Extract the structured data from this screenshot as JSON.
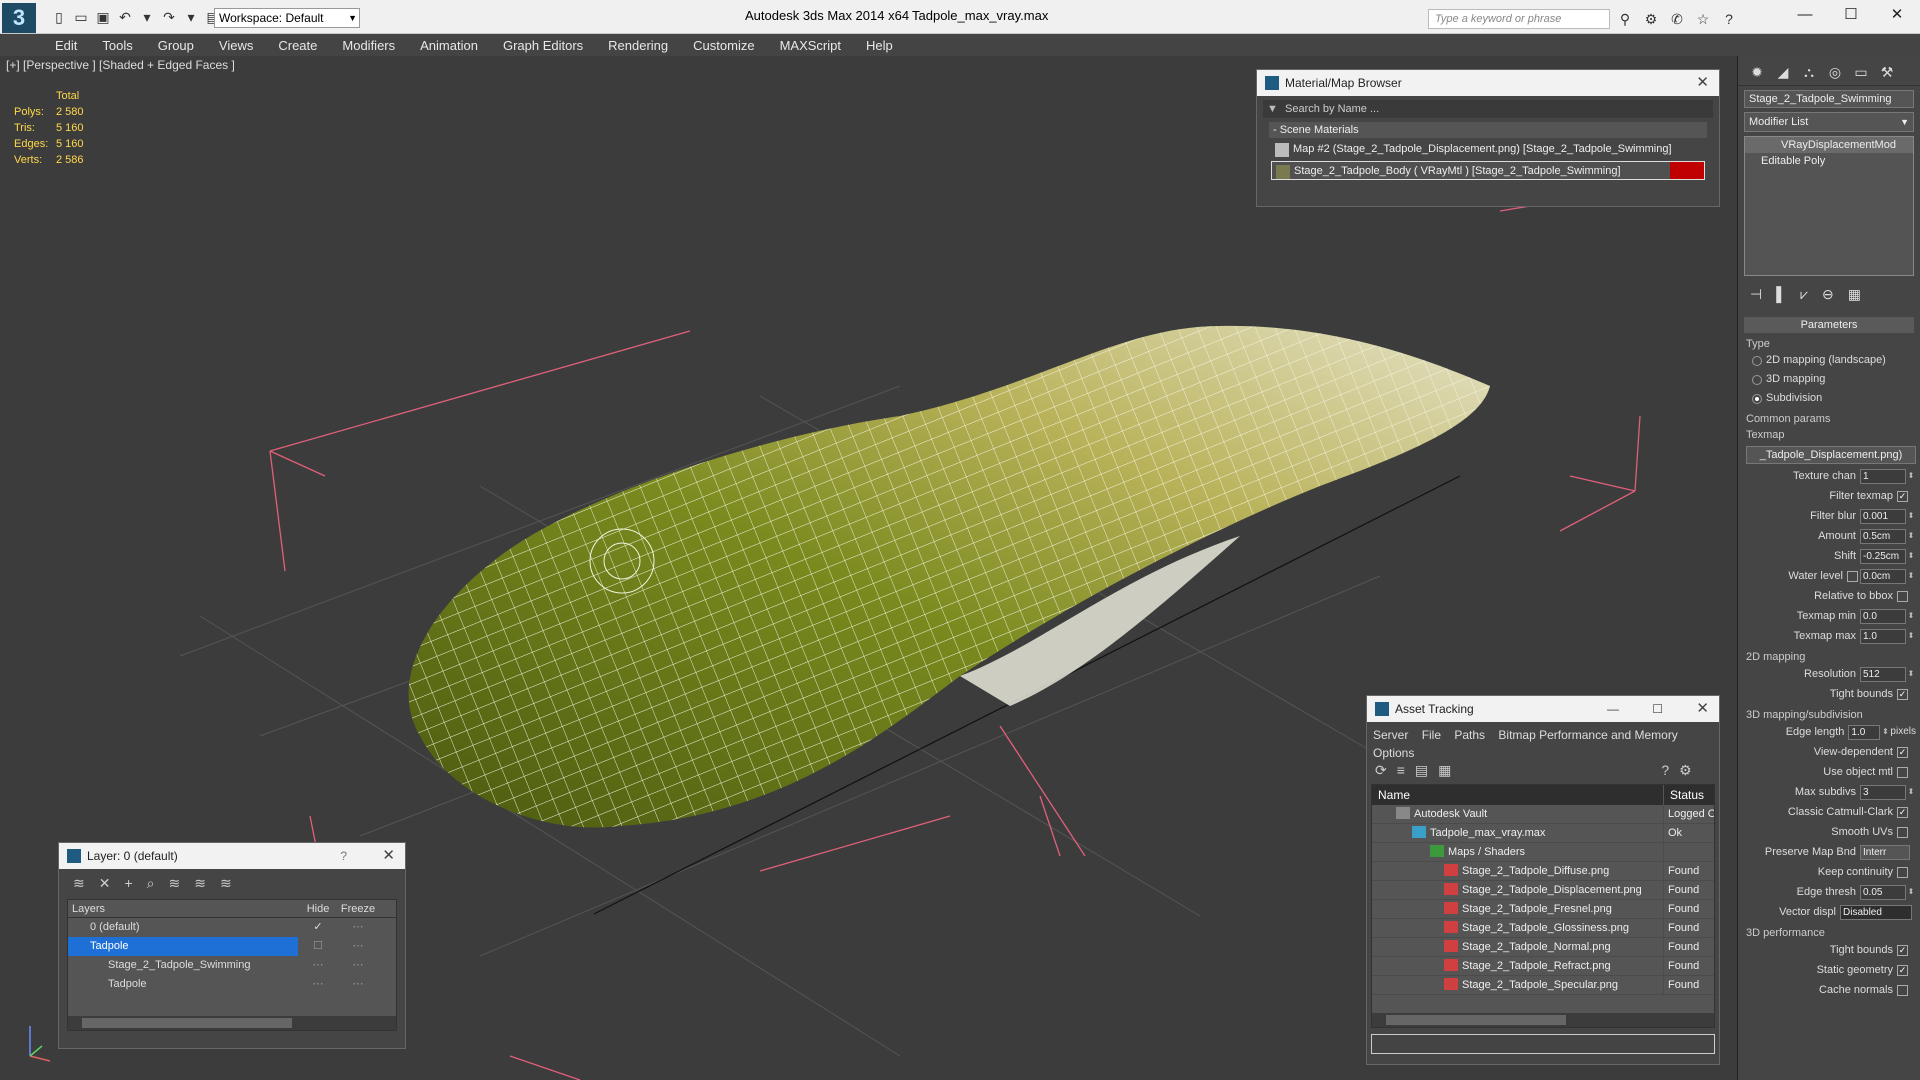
{
  "titlebar": {
    "workspace": "Workspace: Default",
    "app_title": "Autodesk 3ds Max  2014 x64",
    "file_title": "Tadpole_max_vray.max",
    "search_placeholder": "Type a keyword or phrase"
  },
  "menu": [
    "Edit",
    "Tools",
    "Group",
    "Views",
    "Create",
    "Modifiers",
    "Animation",
    "Graph Editors",
    "Rendering",
    "Customize",
    "MAXScript",
    "Help"
  ],
  "viewport": {
    "label": "[+] [Perspective ] [Shaded + Edged Faces ]",
    "stats": {
      "total_label": "Total",
      "polys_label": "Polys:",
      "polys": "2 580",
      "tris_label": "Tris:",
      "tris": "5 160",
      "edges_label": "Edges:",
      "edges": "5 160",
      "verts_label": "Verts:",
      "verts": "2 586"
    }
  },
  "material_browser": {
    "title": "Material/Map Browser",
    "search_placeholder": "Search by Name ...",
    "section": "- Scene Materials",
    "items": [
      "Map #2 (Stage_2_Tadpole_Displacement.png)  [Stage_2_Tadpole_Swimming]",
      "Stage_2_Tadpole_Body  ( VRayMtl )  [Stage_2_Tadpole_Swimming]"
    ]
  },
  "command_panel": {
    "object_name": "Stage_2_Tadpole_Swimming",
    "modifier_list": "Modifier List",
    "stack": [
      "VRayDisplacementMod",
      "Editable Poly"
    ],
    "parameters_title": "Parameters",
    "type_label": "Type",
    "type_options": [
      "2D mapping (landscape)",
      "3D mapping",
      "Subdivision"
    ],
    "common_label": "Common params",
    "texmap_label": "Texmap",
    "texmap_value": "_Tadpole_Displacement.png)",
    "texture_chan_label": "Texture chan",
    "texture_chan": "1",
    "filter_texmap_label": "Filter texmap",
    "filter_blur_label": "Filter blur",
    "filter_blur": "0.001",
    "amount_label": "Amount",
    "amount": "0.5cm",
    "shift_label": "Shift",
    "shift": "-0.25cm",
    "water_level_label": "Water level",
    "water_level": "0.0cm",
    "relative_bbox_label": "Relative to bbox",
    "texmap_min_label": "Texmap min",
    "texmap_min": "0.0",
    "texmap_max_label": "Texmap max",
    "texmap_max": "1.0",
    "mapping2d_label": "2D mapping",
    "resolution_label": "Resolution",
    "resolution": "512",
    "tight_bounds_label": "Tight bounds",
    "mapping3d_label": "3D mapping/subdivision",
    "edge_length_label": "Edge length",
    "edge_length": "1.0",
    "pixels_label": "pixels",
    "view_dependent_label": "View-dependent",
    "use_object_mtl_label": "Use object mtl",
    "max_subdivs_label": "Max subdivs",
    "max_subdivs": "3",
    "classic_label": "Classic Catmull-Clark",
    "smooth_uvs_label": "Smooth UVs",
    "preserve_label": "Preserve Map Bnd",
    "preserve_value": "Interr",
    "keep_continuity_label": "Keep continuity",
    "edge_thresh_label": "Edge thresh",
    "edge_thresh": "0.05",
    "vector_displ_label": "Vector displ",
    "vector_displ": "Disabled",
    "perf_label": "3D performance",
    "perf_tight_label": "Tight bounds",
    "static_geometry_label": "Static geometry",
    "cache_normals_label": "Cache normals"
  },
  "layer_panel": {
    "title": "Layer: 0 (default)",
    "help": "?",
    "col_layers": "Layers",
    "col_hide": "Hide",
    "col_freeze": "Freeze",
    "rows": [
      "0 (default)",
      "Tadpole",
      "Stage_2_Tadpole_Swimming",
      "Tadpole"
    ]
  },
  "asset_panel": {
    "title": "Asset Tracking",
    "menu": [
      "Server",
      "File",
      "Paths",
      "Bitmap Performance and Memory",
      "Options"
    ],
    "col_name": "Name",
    "col_status": "Status",
    "rows": [
      {
        "name": "Autodesk Vault",
        "status": "Logged Out"
      },
      {
        "name": "Tadpole_max_vray.max",
        "status": "Ok"
      },
      {
        "name": "Maps / Shaders",
        "status": ""
      },
      {
        "name": "Stage_2_Tadpole_Diffuse.png",
        "status": "Found"
      },
      {
        "name": "Stage_2_Tadpole_Displacement.png",
        "status": "Found"
      },
      {
        "name": "Stage_2_Tadpole_Fresnel.png",
        "status": "Found"
      },
      {
        "name": "Stage_2_Tadpole_Glossiness.png",
        "status": "Found"
      },
      {
        "name": "Stage_2_Tadpole_Normal.png",
        "status": "Found"
      },
      {
        "name": "Stage_2_Tadpole_Refract.png",
        "status": "Found"
      },
      {
        "name": "Stage_2_Tadpole_Specular.png",
        "status": "Found"
      }
    ]
  },
  "colors": {
    "selection": "#1e6fd6",
    "stats": "#ffd84a",
    "accent_red": "#c00000",
    "mesh": "#7a8a1e"
  }
}
